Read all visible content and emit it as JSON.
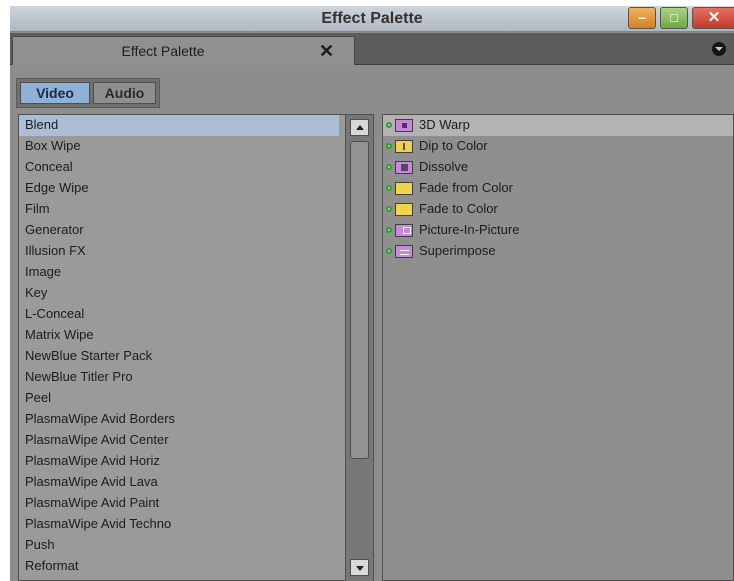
{
  "window": {
    "title": "Effect Palette",
    "buttons": {
      "minimize_glyph": "–",
      "maximize_glyph": "□",
      "close_glyph": "✕"
    }
  },
  "tab": {
    "label": "Effect Palette",
    "close_glyph": "✕"
  },
  "toggles": {
    "video": "Video",
    "audio": "Audio",
    "selected": "Video"
  },
  "categories": [
    "Blend",
    "Box Wipe",
    "Conceal",
    "Edge Wipe",
    "Film",
    "Generator",
    "Illusion FX",
    "Image",
    "Key",
    "L-Conceal",
    "Matrix Wipe",
    "NewBlue Starter Pack",
    "NewBlue Titler Pro",
    "Peel",
    "PlasmaWipe Avid Borders",
    "PlasmaWipe Avid Center",
    "PlasmaWipe Avid Horiz",
    "PlasmaWipe Avid Lava",
    "PlasmaWipe Avid Paint",
    "PlasmaWipe Avid Techno",
    "Push",
    "Reformat"
  ],
  "selected_category": "Blend",
  "effects": [
    {
      "label": "3D Warp",
      "icon": "warp-icon"
    },
    {
      "label": "Dip to Color",
      "icon": "dip-icon"
    },
    {
      "label": "Dissolve",
      "icon": "dissolve-icon"
    },
    {
      "label": "Fade from Color",
      "icon": "fade-icon"
    },
    {
      "label": "Fade to Color",
      "icon": "fade-icon"
    },
    {
      "label": "Picture-In-Picture",
      "icon": "pip-icon"
    },
    {
      "label": "Superimpose",
      "icon": "superimpose-icon"
    }
  ],
  "selected_effect": "3D Warp"
}
